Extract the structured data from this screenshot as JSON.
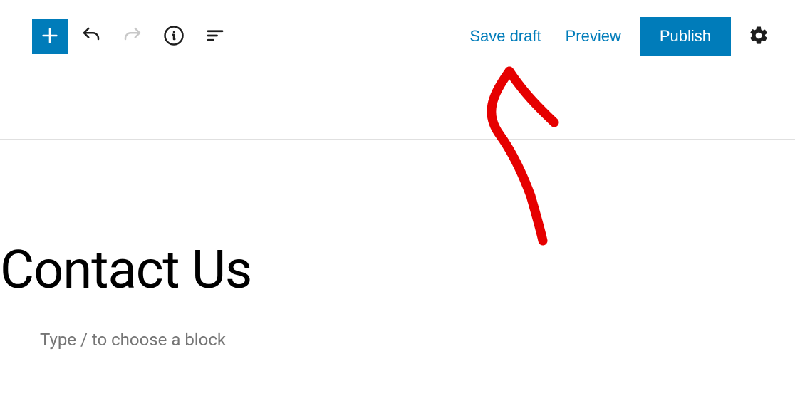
{
  "toolbar": {
    "save_draft_label": "Save draft",
    "preview_label": "Preview",
    "publish_label": "Publish"
  },
  "page": {
    "title": "Contact Us",
    "block_placeholder": "Type / to choose a block"
  },
  "colors": {
    "primary": "#007cba",
    "annotation": "#e60000"
  }
}
